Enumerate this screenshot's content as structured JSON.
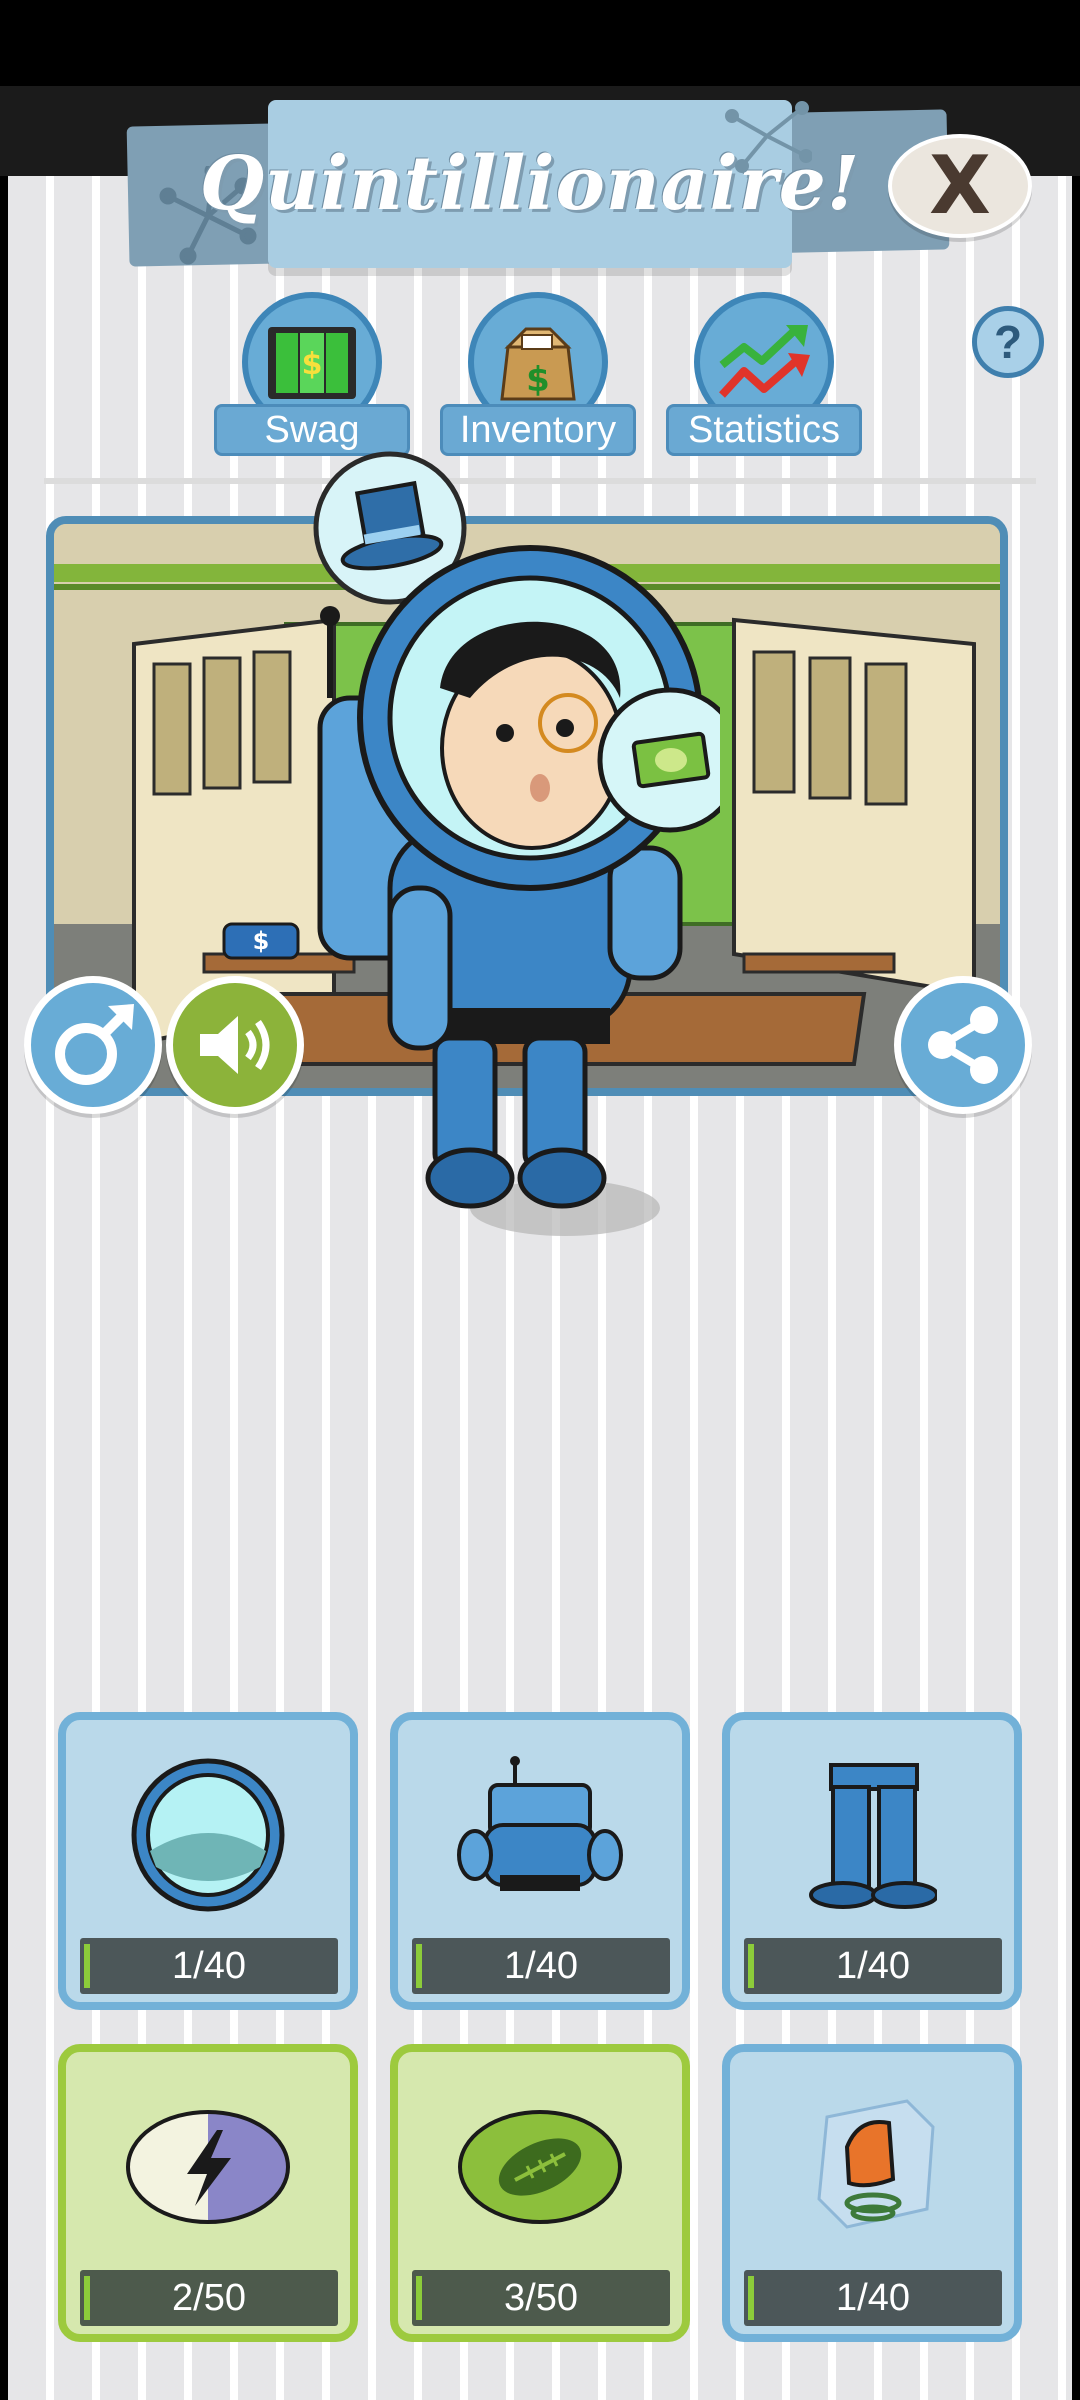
{
  "header": {
    "title": "Quintillionaire!",
    "close_label": "X",
    "help_label": "?"
  },
  "tabs": [
    {
      "label": "Swag",
      "icon": "money-doors-icon"
    },
    {
      "label": "Inventory",
      "icon": "money-box-icon"
    },
    {
      "label": "Statistics",
      "icon": "stocks-arrows-icon"
    }
  ],
  "scene": {
    "controls": [
      "gender-toggle",
      "sound",
      "share"
    ]
  },
  "items": [
    {
      "name": "helmet",
      "count": "1/40",
      "style": "blue",
      "progress": 0.025
    },
    {
      "name": "suit",
      "count": "1/40",
      "style": "blue",
      "progress": 0.025
    },
    {
      "name": "pants",
      "count": "1/40",
      "style": "blue",
      "progress": 0.025
    },
    {
      "name": "energy",
      "count": "2/50",
      "style": "green",
      "progress": 0.04
    },
    {
      "name": "football",
      "count": "3/50",
      "style": "green",
      "progress": 0.06
    },
    {
      "name": "frozen-chair",
      "count": "1/40",
      "style": "blue",
      "progress": 0.025
    }
  ],
  "colors": {
    "accent_blue": "#4f8db6",
    "card_blue": "#bad9ea",
    "card_green": "#d6e8ae",
    "sound_green": "#8cb33a"
  }
}
